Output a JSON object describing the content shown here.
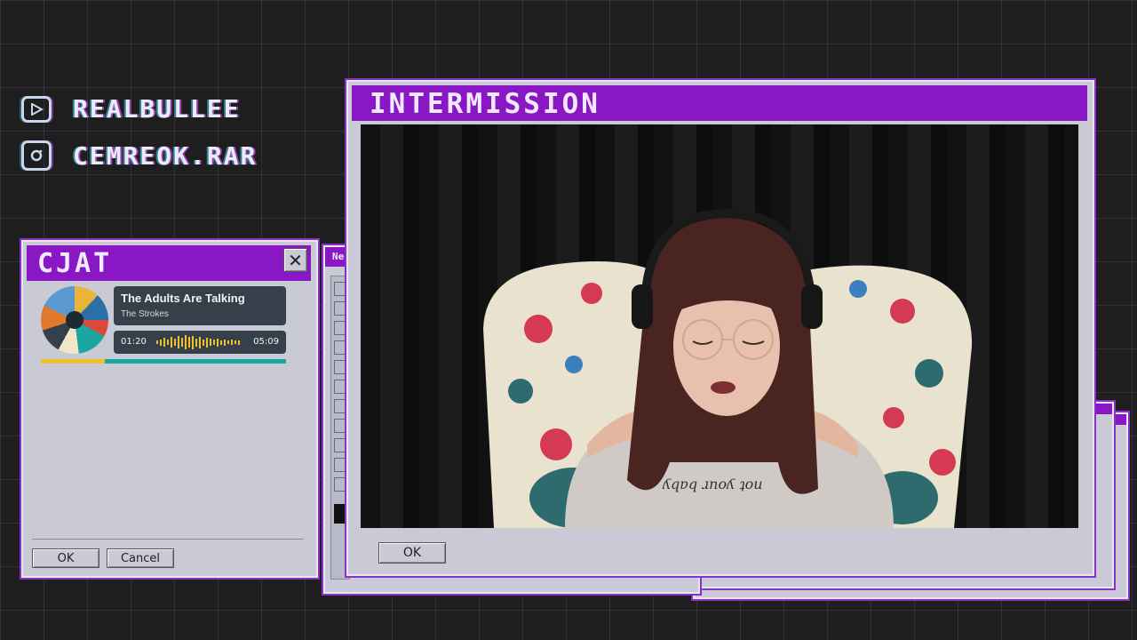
{
  "socials": [
    {
      "icon": "youtube-icon",
      "handle": "REALBULLEE"
    },
    {
      "icon": "instagram-icon",
      "handle": "CEMREOK.RAR"
    }
  ],
  "chat_window": {
    "title": "CJAT",
    "now_playing": {
      "song": "The Adults Are Talking",
      "artist": "The Strokes",
      "elapsed": "01:20",
      "duration": "05:09",
      "progress": 0.26
    },
    "ok_label": "OK",
    "cancel_label": "Cancel"
  },
  "back_window": {
    "title": "Ne"
  },
  "main_window": {
    "title": "INTERMISSION",
    "ok_label": "OK"
  },
  "colors": {
    "accent": "#8a17c4",
    "window_bg": "#c9cad6",
    "waveform": "#f0c02c",
    "progress_teal": "#1aa7a0"
  }
}
